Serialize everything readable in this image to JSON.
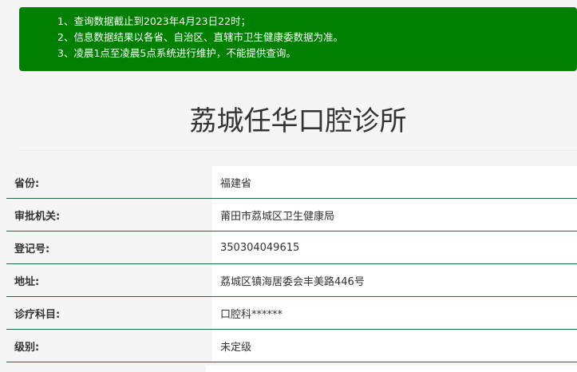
{
  "notice": {
    "line1": "1、查询数据截止到2023年4月23日22时；",
    "line2": "2、信息数据结果以各省、自治区、直辖市卫生健康委数据为准。",
    "line3": "3、凌晨1点至凌晨5点系统进行维护，不能提供查询。",
    "bg_color": "#008000"
  },
  "title": "荔城任华口腔诊所",
  "rows": [
    {
      "label": "省份:",
      "value": "福建省"
    },
    {
      "label": "审批机关:",
      "value": "莆田市荔城区卫生健康局"
    },
    {
      "label": "登记号:",
      "value": "350304049615"
    },
    {
      "label": "地址:",
      "value": "荔城区镇海居委会丰美路446号"
    },
    {
      "label": "诊疗科目:",
      "value": "口腔科******"
    },
    {
      "label": "级别:",
      "value": "未定级"
    }
  ],
  "row_border_color": "#1f6b3f"
}
